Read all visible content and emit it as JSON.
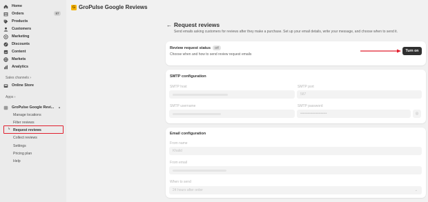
{
  "sidebar": {
    "nav": [
      {
        "label": "Home",
        "icon": "home-icon"
      },
      {
        "label": "Orders",
        "icon": "orders-icon",
        "badge": "87"
      },
      {
        "label": "Products",
        "icon": "tag-icon"
      },
      {
        "label": "Customers",
        "icon": "person-icon"
      },
      {
        "label": "Marketing",
        "icon": "target-icon"
      },
      {
        "label": "Discounts",
        "icon": "discount-icon"
      },
      {
        "label": "Content",
        "icon": "content-icon"
      },
      {
        "label": "Markets",
        "icon": "globe-icon"
      },
      {
        "label": "Analytics",
        "icon": "chart-icon"
      }
    ],
    "sales_channels_label": "Sales channels",
    "online_store": "Online Store",
    "apps_label": "Apps",
    "app_name": "GroPulse Google Revi...",
    "sub_items": [
      "Manage locations",
      "Filter reviews",
      "Request reviews",
      "Collect reviews",
      "Settings",
      "Pricing plan",
      "Help"
    ]
  },
  "header": {
    "app_title": "GroPulse Google Reviews",
    "logo_glyph": "G"
  },
  "page": {
    "back_glyph": "←",
    "title": "Request reviews",
    "subtitle": "Send emails asking customers for reviews after they make a purchase. Set up your email details, write your message, and choose when to send it."
  },
  "status_card": {
    "title": "Review request status",
    "status": "Off",
    "description": "Choose when and how to send review request emails",
    "button_label": "Turn on"
  },
  "smtp": {
    "title": "SMTP configuration",
    "host_label": "SMTP host",
    "port_label": "SMTP port",
    "port_value": "587",
    "username_label": "SMTP username",
    "password_label": "SMTP password",
    "password_value": "••••••••••••••••••••••"
  },
  "email": {
    "title": "Email configuration",
    "from_name_label": "From name",
    "from_name_value": "Khalid",
    "from_email_label": "From email",
    "when_label": "When to send",
    "when_value": "24 hours after order"
  },
  "colors": {
    "annotation_red": "#e11d2c",
    "primary_button": "#303030"
  }
}
